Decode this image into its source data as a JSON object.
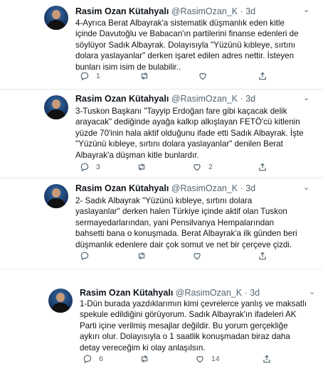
{
  "tweets": [
    {
      "name": "Rasim Ozan Kütahyalı",
      "handle": "@RasimOzan_K",
      "separator": "·",
      "time": "3d",
      "caret": "⌄",
      "text": "4-Ayrıca Berat Albayrak'a sistematik düşmanlık eden kitle içinde Davutoğlu ve Babacan'ın partilerini finanse edenleri de söylüyor Sadık Albayrak. Dolayısıyla \"Yüzünü kıbleye, sırtını dolara yaslayanlar\" derken işaret edilen adres nettir. İsteyen bunları isim isim de bulabilir..",
      "replies": "1",
      "retweets": "",
      "likes": "",
      "share": ""
    },
    {
      "name": "Rasim Ozan Kütahyalı",
      "handle": "@RasimOzan_K",
      "separator": "·",
      "time": "3d",
      "caret": "⌄",
      "text": "3-Tuskon Başkanı \"Tayyip Erdoğan fare gibi kaçacak delik arayacak\" dediğinde ayağa kalkıp alkışlayan FETÖ'cü kitlenin yüzde 70'inin hala aktif olduğunu ifade etti Sadık Albayrak. İşte \"Yüzünü kıbleye, sırtını dolara yaslayanlar\" denilen Berat Albayrak'a düşman kitle bunlardır.",
      "replies": "3",
      "retweets": "",
      "likes": "2",
      "share": ""
    },
    {
      "name": "Rasim Ozan Kütahyalı",
      "handle": "@RasimOzan_K",
      "separator": "·",
      "time": "3d",
      "caret": "⌄",
      "text": "2- Sadık Albayrak \"Yüzünü kıbleye, sırtını dolara yaslayanlar\" derken halen Türkiye içinde aktif olan Tuskon sermayedarlarından, yani Pensilvanya Hempalarından bahsetti bana o konuşmada. Berat Albayrak'a ilk günden beri düşmanlık edenlere dair çok somut ve net bir çerçeve çizdi.",
      "replies": "",
      "retweets": "",
      "likes": "",
      "share": ""
    },
    {
      "name": "Rasim Ozan Kütahyalı",
      "handle": "@RasimOzan_K",
      "separator": "·",
      "time": "3d",
      "caret": "⌄",
      "text": "1-Dün burada yazdıklarımın kimi çevrelerce yanlış ve maksatlı spekule edildiğini görüyorum. Sadık Albayrak'ın ifadeleri AK Parti içine verilmiş mesajlar değildir. Bu yorum gerçekliğe aykırı olur. Dolayısıyla o 1 saatlik konuşmadan biraz daha detay vereceğim ki olay anlaşılsın.",
      "replies": "6",
      "retweets": "",
      "likes": "14",
      "share": ""
    }
  ],
  "icons": {
    "reply": "reply-icon",
    "retweet": "retweet-icon",
    "like": "heart-icon",
    "share": "share-icon"
  },
  "colors": {
    "text": "#0f1419",
    "muted": "#536471",
    "divider": "#e6e9eb"
  }
}
